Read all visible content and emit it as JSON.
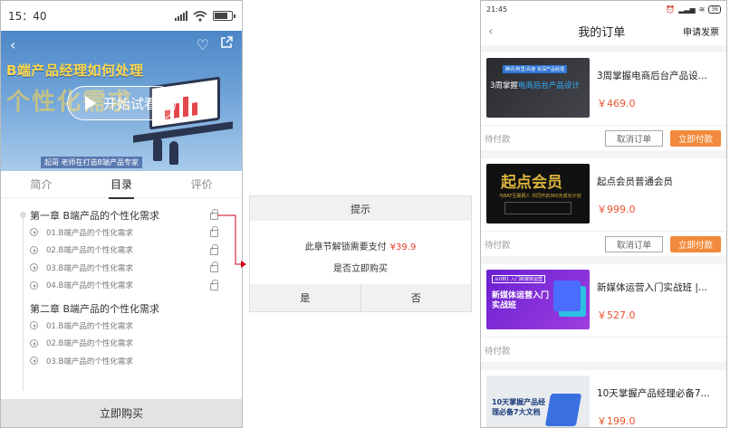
{
  "phone1": {
    "status": {
      "time": "15：40"
    },
    "hero": {
      "title": "B端产品经理如何处理",
      "subtitle": "个性化需求",
      "play_label": "开始试看",
      "note": "起哥 老师在打造B端产品专家"
    },
    "tabs": [
      {
        "label": "简介"
      },
      {
        "label": "目录"
      },
      {
        "label": "评价"
      }
    ],
    "chapters": [
      {
        "title": "第一章 B端产品的个性化需求",
        "lessons": [
          {
            "label": "01.B端产品的个性化需求"
          },
          {
            "label": "02.B端产品的个性化需求"
          },
          {
            "label": "03.B端产品的个性化需求"
          },
          {
            "label": "04.B端产品的个性化需求"
          }
        ]
      },
      {
        "title": "第二章 B端产品的个性化需求",
        "lessons": [
          {
            "label": "01.B端产品的个性化需求"
          },
          {
            "label": "02.B端产品的个性化需求"
          },
          {
            "label": "03.B端产品的个性化需求"
          }
        ]
      }
    ],
    "buy_label": "立即购买"
  },
  "dialog": {
    "title": "提示",
    "message": "此章节解锁需要支付",
    "price": "¥39.9",
    "question": "是否立即购买",
    "yes": "是",
    "no": "否"
  },
  "phone2": {
    "status": {
      "time": "21:45",
      "battery": "36"
    },
    "header": {
      "title": "我的订单",
      "action": "申请发票"
    },
    "orders": [
      {
        "name": "3周掌握电商后台产品设...",
        "price": "￥469.0",
        "status": "待付款",
        "cancel": "取消订单",
        "pay": "立即付款",
        "thumb_tag": "腾讯/阿里/百度 资深产品经理",
        "thumb_title_a": "3周掌握",
        "thumb_title_b": "电商后台产品设计"
      },
      {
        "name": "起点会员普通会员",
        "price": "￥999.0",
        "status": "待付款",
        "cancel": "取消订单",
        "pay": "立即付款",
        "thumb_title": "起点会员",
        "thumb_sub": "与BAT互联网人 共同开启360天成长计划"
      },
      {
        "name": "新媒体运营入门实战班 |...",
        "price": "￥527.0",
        "status": "待付款",
        "thumb_tag": "从0到1 入门新媒体运营",
        "thumb_title": "新媒体运营入门实战班"
      },
      {
        "name": "10天掌握产品经理必备7...",
        "price": "￥199.0",
        "thumb_title": "10天掌握产品经理必备7大文档"
      }
    ]
  }
}
